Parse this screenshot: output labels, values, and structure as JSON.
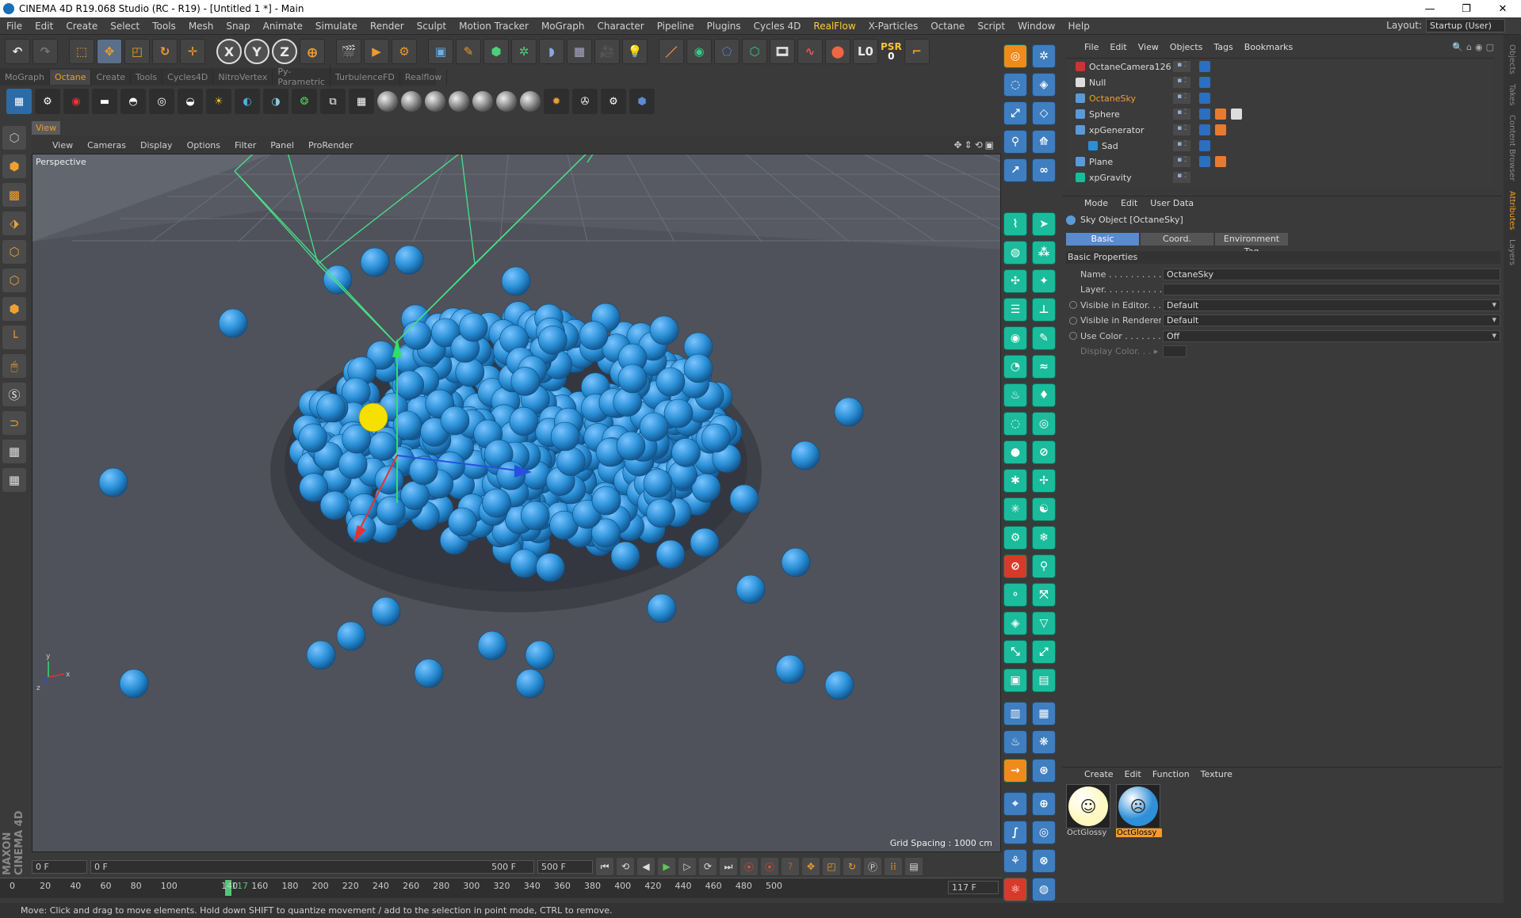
{
  "window": {
    "title": "CINEMA 4D R19.068 Studio (RC - R19) - [Untitled 1 *] - Main",
    "controls": [
      "—",
      "❐",
      "✕"
    ]
  },
  "menubar": {
    "items": [
      "File",
      "Edit",
      "Create",
      "Select",
      "Tools",
      "Mesh",
      "Snap",
      "Animate",
      "Simulate",
      "Render",
      "Sculpt",
      "Motion Tracker",
      "MoGraph",
      "Character",
      "Pipeline",
      "Plugins",
      "Cycles 4D",
      "RealFlow",
      "X-Particles",
      "Octane",
      "Script",
      "Window",
      "Help"
    ],
    "accent_item": "RealFlow",
    "layout_label": "Layout:",
    "layout_value": "Startup (User)"
  },
  "toolbar": {
    "psr_label": "PSR",
    "psr_value": "0",
    "axis_x": "X",
    "axis_y": "Y",
    "axis_z": "Z"
  },
  "tabs": [
    "MoGraph",
    "Octane",
    "Create",
    "Tools",
    "Cycles4D",
    "NitroVertex",
    "Py-Parametric",
    "TurbulenceFD",
    "Realflow"
  ],
  "active_tab": "Octane",
  "viewport": {
    "panel_tab": "View",
    "menu": [
      "View",
      "Cameras",
      "Display",
      "Options",
      "Filter",
      "Panel",
      "ProRender"
    ],
    "label": "Perspective",
    "grid_spacing": "Grid Spacing : 1000 cm",
    "axis_labels": {
      "y": "y",
      "x": "x",
      "z": "z"
    }
  },
  "timeline": {
    "start_frame": "0 F",
    "range_start": "0 F",
    "range_end": "500 F",
    "end_frame": "500 F",
    "current_frame_field": "117 F",
    "ruler_ticks": [
      "0",
      "20",
      "40",
      "60",
      "80",
      "100",
      "140",
      "160",
      "180",
      "200",
      "220",
      "240",
      "260",
      "280",
      "300",
      "320",
      "340",
      "360",
      "380",
      "400",
      "420",
      "440",
      "460",
      "480",
      "500"
    ],
    "current_frame": "117"
  },
  "status": "Move: Click and drag to move elements. Hold down SHIFT to quantize movement / add to the selection in point mode, CTRL to remove.",
  "object_manager": {
    "menu": [
      "File",
      "Edit",
      "View",
      "Objects",
      "Tags",
      "Bookmarks"
    ],
    "objects": [
      {
        "name": "OctaneCamera126",
        "selected": false
      },
      {
        "name": "Null",
        "selected": false
      },
      {
        "name": "OctaneSky",
        "selected": true
      },
      {
        "name": "Sphere",
        "selected": false
      },
      {
        "name": "xpGenerator",
        "selected": false
      },
      {
        "name": "Sad",
        "selected": false
      },
      {
        "name": "Plane",
        "selected": false
      },
      {
        "name": "xpGravity",
        "selected": false
      }
    ]
  },
  "side_tabs": [
    "Objects",
    "Takes",
    "Content Browser",
    "Attributes",
    "Layers"
  ],
  "attributes": {
    "menu": [
      "Mode",
      "Edit",
      "User Data"
    ],
    "title": "Sky Object [OctaneSky]",
    "tabs": [
      "Basic",
      "Coord.",
      "Environment Tag"
    ],
    "active_tab": "Basic",
    "section": "Basic Properties",
    "props": [
      {
        "label": "Name . . . . . . . . . .",
        "value": "OctaneSky"
      },
      {
        "label": "Layer. . . . . . . . . . .",
        "value": ""
      },
      {
        "label": "Visible in Editor. . .",
        "value": "Default"
      },
      {
        "label": "Visible in Renderer",
        "value": "Default"
      },
      {
        "label": "Use Color . . . . . . .",
        "value": "Off"
      },
      {
        "label": "Display Color. . . ▸",
        "value": ""
      }
    ]
  },
  "materials": {
    "menu": [
      "Create",
      "Edit",
      "Function",
      "Texture"
    ],
    "items": [
      {
        "name": "OctGlossy",
        "color": "#fff8c0",
        "face": "☺",
        "selected": false
      },
      {
        "name": "OctGlossy",
        "color": "#2f8fd8",
        "face": "☹",
        "selected": true
      }
    ]
  },
  "colors": {
    "accent": "#f39c2b",
    "sphere": "#2a8fd6",
    "smiley": "#f5e000",
    "camera_wire": "#46e28a",
    "palette_teal": "#1abc9c"
  },
  "icons": {
    "toolbar": [
      "undo-icon",
      "redo-icon",
      "live-selection-icon",
      "move-icon",
      "scale-icon",
      "rotate-icon",
      "place-icon",
      "world-coord-icon",
      "render-view-icon",
      "render-picture-viewer-icon",
      "edit-render-settings-icon",
      "cube-icon",
      "pen-icon",
      "subdivision-icon",
      "cloner-icon",
      "deformer-icon",
      "floor-icon",
      "camera-icon",
      "light-icon"
    ]
  }
}
